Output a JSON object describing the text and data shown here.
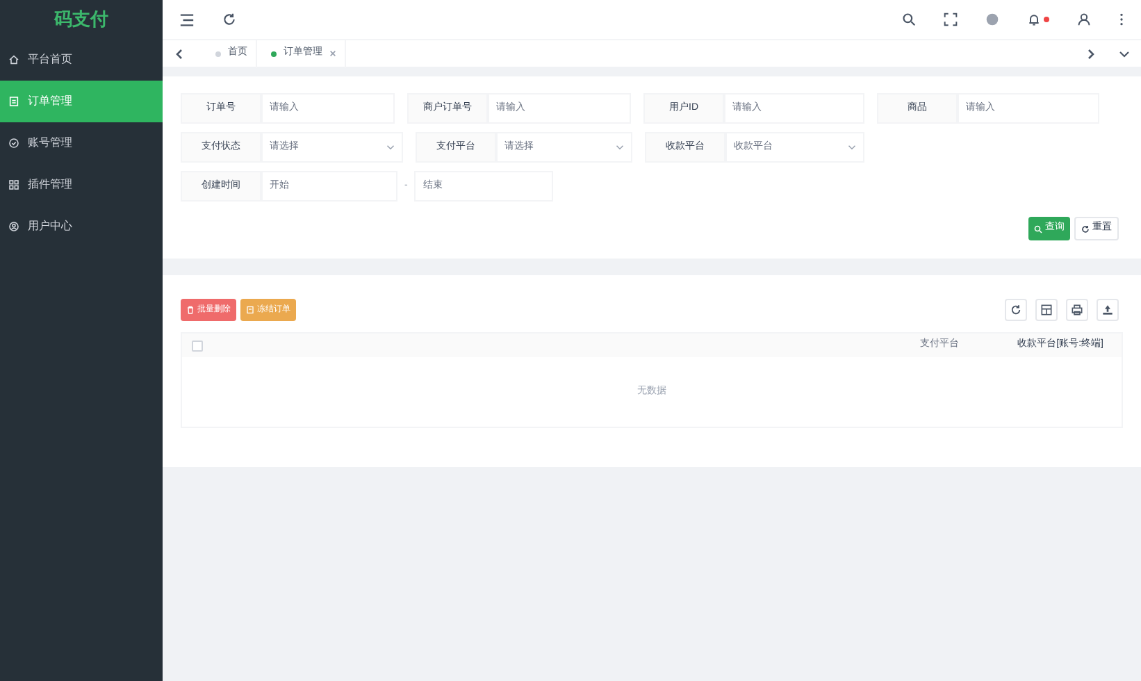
{
  "sidebar": {
    "logo": "码支付",
    "items": [
      {
        "label": "平台首页",
        "selected": false
      },
      {
        "label": "订单管理",
        "selected": true
      },
      {
        "label": "账号管理",
        "selected": false
      },
      {
        "label": "插件管理",
        "selected": false
      },
      {
        "label": "用户中心",
        "selected": false
      }
    ]
  },
  "header": {
    "notification_dot": true
  },
  "tabs": [
    {
      "label": "首页",
      "selected": false,
      "closable": false
    },
    {
      "label": "订单管理",
      "selected": true,
      "closable": true
    }
  ],
  "filters": [
    {
      "kind": "input",
      "label": "订单号",
      "placeholder": "请输入"
    },
    {
      "kind": "input",
      "label": "商户订单号",
      "placeholder": "请输入"
    },
    {
      "kind": "input",
      "label": "用户ID",
      "placeholder": "请输入"
    },
    {
      "kind": "input",
      "label": "商品",
      "placeholder": "请输入"
    },
    {
      "kind": "select",
      "label": "支付状态",
      "placeholder": "请选择"
    },
    {
      "kind": "select",
      "label": "支付平台",
      "placeholder": "请选择"
    },
    {
      "kind": "select",
      "label": "收款平台",
      "placeholder": "收款平台"
    },
    {
      "kind": "range",
      "label": "创建时间",
      "placeholder": "开始",
      "placeholder_end": "结束",
      "separator": "-"
    }
  ],
  "search_button": "查询",
  "reset_button": "重置",
  "actions": [
    {
      "label": "批量删除",
      "kind": "danger"
    },
    {
      "label": "冻结订单",
      "kind": "warning"
    }
  ],
  "table": {
    "select_all": {
      "checked": false
    },
    "columns": [
      "支付平台",
      "收款平台[账号:终端]"
    ],
    "empty_text": "无数据"
  }
}
